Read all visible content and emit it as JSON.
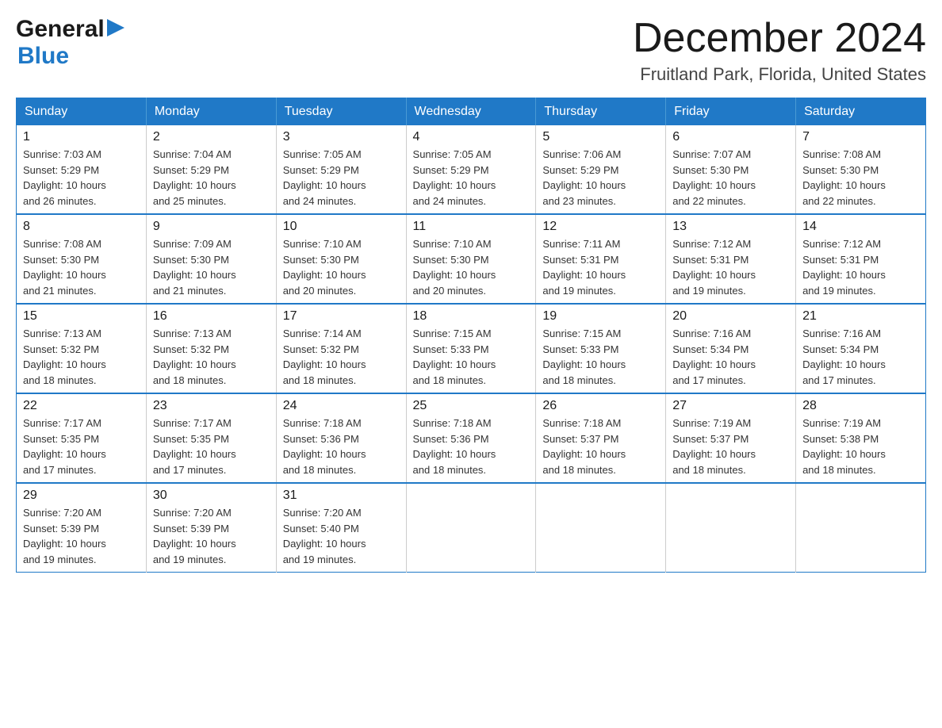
{
  "header": {
    "logo_general": "General",
    "logo_blue": "Blue",
    "month_title": "December 2024",
    "location": "Fruitland Park, Florida, United States"
  },
  "days_of_week": [
    "Sunday",
    "Monday",
    "Tuesday",
    "Wednesday",
    "Thursday",
    "Friday",
    "Saturday"
  ],
  "weeks": [
    [
      {
        "day": "1",
        "info": "Sunrise: 7:03 AM\nSunset: 5:29 PM\nDaylight: 10 hours\nand 26 minutes."
      },
      {
        "day": "2",
        "info": "Sunrise: 7:04 AM\nSunset: 5:29 PM\nDaylight: 10 hours\nand 25 minutes."
      },
      {
        "day": "3",
        "info": "Sunrise: 7:05 AM\nSunset: 5:29 PM\nDaylight: 10 hours\nand 24 minutes."
      },
      {
        "day": "4",
        "info": "Sunrise: 7:05 AM\nSunset: 5:29 PM\nDaylight: 10 hours\nand 24 minutes."
      },
      {
        "day": "5",
        "info": "Sunrise: 7:06 AM\nSunset: 5:29 PM\nDaylight: 10 hours\nand 23 minutes."
      },
      {
        "day": "6",
        "info": "Sunrise: 7:07 AM\nSunset: 5:30 PM\nDaylight: 10 hours\nand 22 minutes."
      },
      {
        "day": "7",
        "info": "Sunrise: 7:08 AM\nSunset: 5:30 PM\nDaylight: 10 hours\nand 22 minutes."
      }
    ],
    [
      {
        "day": "8",
        "info": "Sunrise: 7:08 AM\nSunset: 5:30 PM\nDaylight: 10 hours\nand 21 minutes."
      },
      {
        "day": "9",
        "info": "Sunrise: 7:09 AM\nSunset: 5:30 PM\nDaylight: 10 hours\nand 21 minutes."
      },
      {
        "day": "10",
        "info": "Sunrise: 7:10 AM\nSunset: 5:30 PM\nDaylight: 10 hours\nand 20 minutes."
      },
      {
        "day": "11",
        "info": "Sunrise: 7:10 AM\nSunset: 5:30 PM\nDaylight: 10 hours\nand 20 minutes."
      },
      {
        "day": "12",
        "info": "Sunrise: 7:11 AM\nSunset: 5:31 PM\nDaylight: 10 hours\nand 19 minutes."
      },
      {
        "day": "13",
        "info": "Sunrise: 7:12 AM\nSunset: 5:31 PM\nDaylight: 10 hours\nand 19 minutes."
      },
      {
        "day": "14",
        "info": "Sunrise: 7:12 AM\nSunset: 5:31 PM\nDaylight: 10 hours\nand 19 minutes."
      }
    ],
    [
      {
        "day": "15",
        "info": "Sunrise: 7:13 AM\nSunset: 5:32 PM\nDaylight: 10 hours\nand 18 minutes."
      },
      {
        "day": "16",
        "info": "Sunrise: 7:13 AM\nSunset: 5:32 PM\nDaylight: 10 hours\nand 18 minutes."
      },
      {
        "day": "17",
        "info": "Sunrise: 7:14 AM\nSunset: 5:32 PM\nDaylight: 10 hours\nand 18 minutes."
      },
      {
        "day": "18",
        "info": "Sunrise: 7:15 AM\nSunset: 5:33 PM\nDaylight: 10 hours\nand 18 minutes."
      },
      {
        "day": "19",
        "info": "Sunrise: 7:15 AM\nSunset: 5:33 PM\nDaylight: 10 hours\nand 18 minutes."
      },
      {
        "day": "20",
        "info": "Sunrise: 7:16 AM\nSunset: 5:34 PM\nDaylight: 10 hours\nand 17 minutes."
      },
      {
        "day": "21",
        "info": "Sunrise: 7:16 AM\nSunset: 5:34 PM\nDaylight: 10 hours\nand 17 minutes."
      }
    ],
    [
      {
        "day": "22",
        "info": "Sunrise: 7:17 AM\nSunset: 5:35 PM\nDaylight: 10 hours\nand 17 minutes."
      },
      {
        "day": "23",
        "info": "Sunrise: 7:17 AM\nSunset: 5:35 PM\nDaylight: 10 hours\nand 17 minutes."
      },
      {
        "day": "24",
        "info": "Sunrise: 7:18 AM\nSunset: 5:36 PM\nDaylight: 10 hours\nand 18 minutes."
      },
      {
        "day": "25",
        "info": "Sunrise: 7:18 AM\nSunset: 5:36 PM\nDaylight: 10 hours\nand 18 minutes."
      },
      {
        "day": "26",
        "info": "Sunrise: 7:18 AM\nSunset: 5:37 PM\nDaylight: 10 hours\nand 18 minutes."
      },
      {
        "day": "27",
        "info": "Sunrise: 7:19 AM\nSunset: 5:37 PM\nDaylight: 10 hours\nand 18 minutes."
      },
      {
        "day": "28",
        "info": "Sunrise: 7:19 AM\nSunset: 5:38 PM\nDaylight: 10 hours\nand 18 minutes."
      }
    ],
    [
      {
        "day": "29",
        "info": "Sunrise: 7:20 AM\nSunset: 5:39 PM\nDaylight: 10 hours\nand 19 minutes."
      },
      {
        "day": "30",
        "info": "Sunrise: 7:20 AM\nSunset: 5:39 PM\nDaylight: 10 hours\nand 19 minutes."
      },
      {
        "day": "31",
        "info": "Sunrise: 7:20 AM\nSunset: 5:40 PM\nDaylight: 10 hours\nand 19 minutes."
      },
      {
        "day": "",
        "info": ""
      },
      {
        "day": "",
        "info": ""
      },
      {
        "day": "",
        "info": ""
      },
      {
        "day": "",
        "info": ""
      }
    ]
  ]
}
